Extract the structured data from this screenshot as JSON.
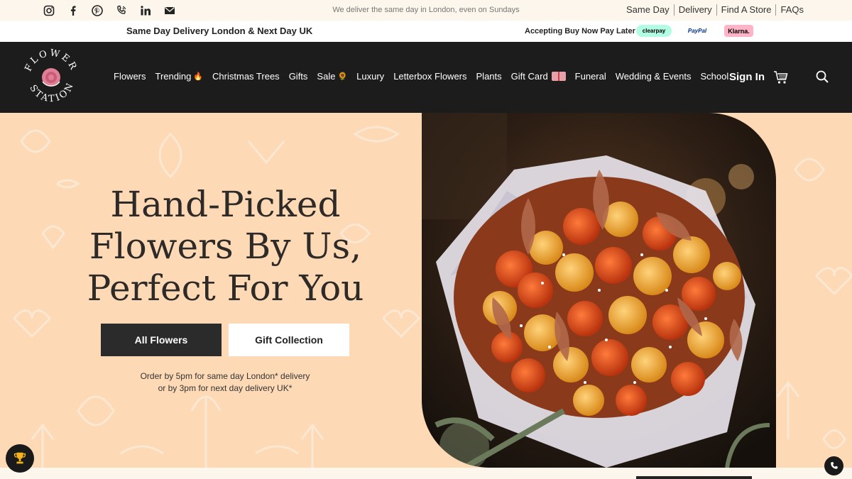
{
  "topbar": {
    "social_icons": [
      "instagram-icon",
      "facebook-icon",
      "pinterest-icon",
      "phone-icon",
      "linkedin-icon",
      "mail-icon"
    ],
    "tagline": "We deliver the same day in London, even on Sundays",
    "links": [
      "Same Day",
      "Delivery",
      "Find A Store",
      "FAQs"
    ]
  },
  "strip": {
    "left": "Same Day Delivery London & Next Day UK",
    "right": "Accepting Buy Now Pay Later",
    "payments": {
      "clearpay": "clearpay",
      "paypal": "PayPal",
      "klarna": "Klarna."
    }
  },
  "nav": {
    "logo_text": "FLOWER STATION",
    "items": [
      "Flowers",
      "Trending",
      "Christmas Trees",
      "Gifts",
      "Sale",
      "Luxury",
      "Letterbox Flowers",
      "Plants",
      "Gift Card",
      "Funeral",
      "Wedding & Events",
      "School"
    ],
    "trending_emoji": "🔥",
    "sale_emoji": "🌻",
    "sign_in": "Sign In"
  },
  "hero": {
    "headline_line1": "Hand-Picked",
    "headline_line2": "Flowers By Us,",
    "headline_line3": "Perfect For You",
    "primary_button": "All Flowers",
    "secondary_button": "Gift Collection",
    "note_line1": "Order by 5pm for same day London* delivery",
    "note_line2": "or by 3pm for next day delivery UK*"
  },
  "colors": {
    "nav_bg": "#1c1c1c",
    "hero_bg": "#fdd9b5",
    "topbar_bg": "#fdf6ec",
    "button_dark": "#2b2b2b"
  }
}
